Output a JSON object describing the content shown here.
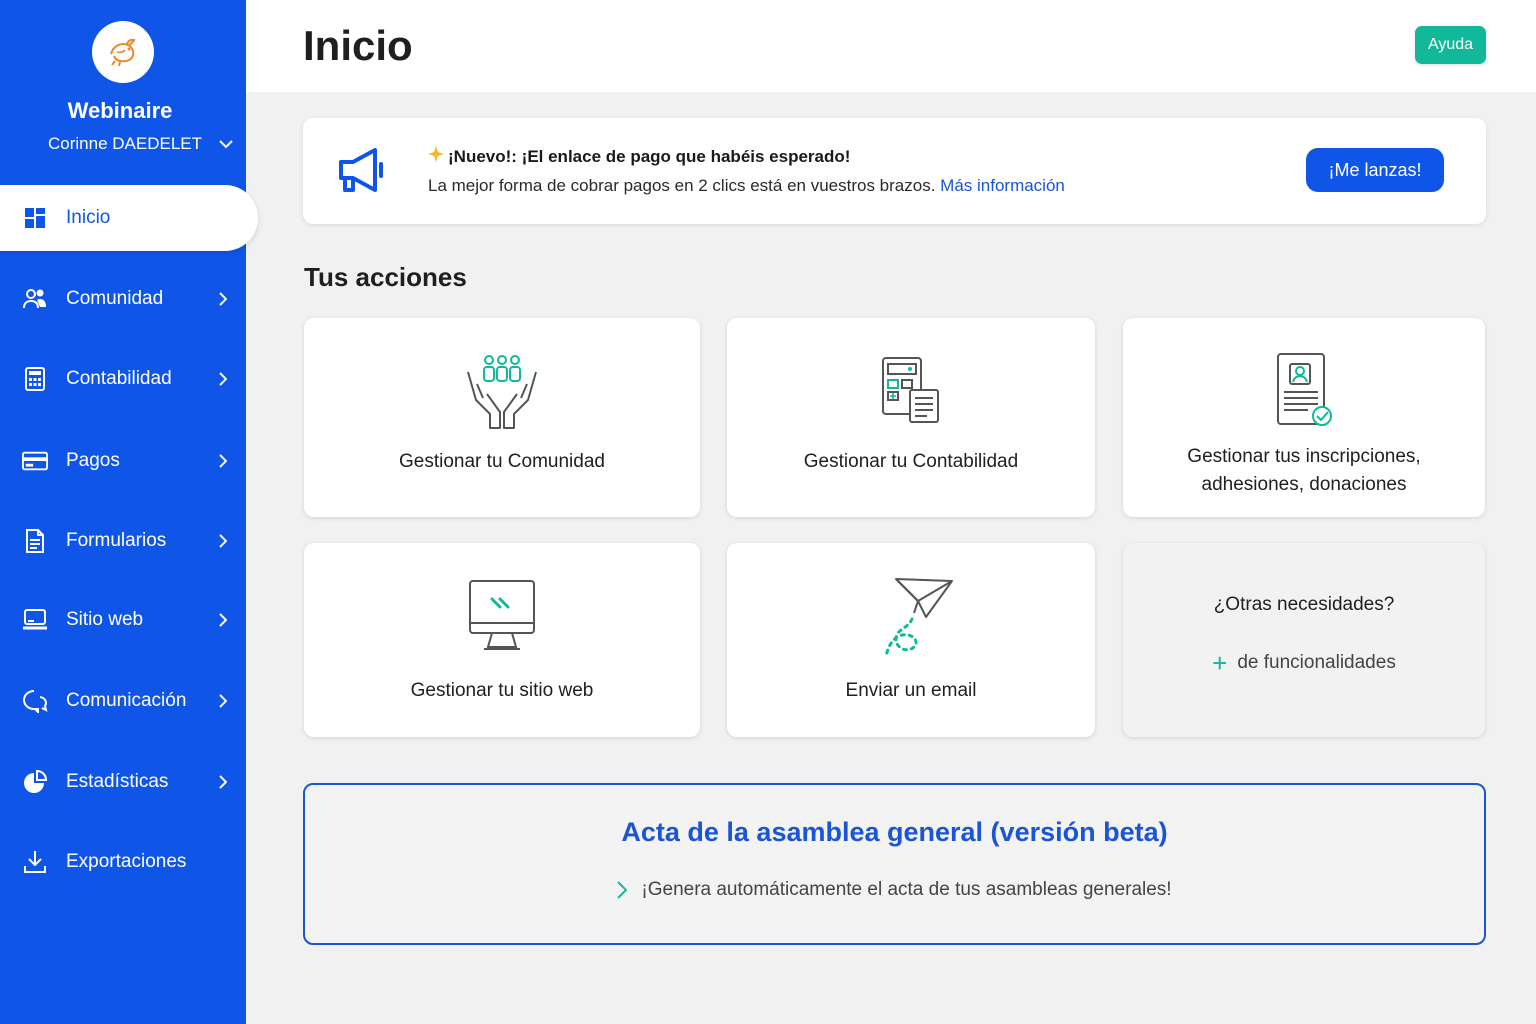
{
  "sidebar": {
    "org_name": "Webinaire",
    "user_name": "Corinne DAEDELET",
    "items": [
      {
        "label": "Inicio",
        "icon": "dashboard-icon"
      },
      {
        "label": "Comunidad",
        "icon": "people-icon"
      },
      {
        "label": "Contabilidad",
        "icon": "calculator-icon"
      },
      {
        "label": "Pagos",
        "icon": "credit-card-icon"
      },
      {
        "label": "Formularios",
        "icon": "document-icon"
      },
      {
        "label": "Sitio web",
        "icon": "laptop-icon"
      },
      {
        "label": "Comunicación",
        "icon": "chat-icon"
      },
      {
        "label": "Estadísticas",
        "icon": "pie-chart-icon"
      },
      {
        "label": "Exportaciones",
        "icon": "download-icon"
      }
    ]
  },
  "header": {
    "title": "Inicio",
    "help_label": "Ayuda"
  },
  "announcement": {
    "title": "¡Nuevo!: ¡El enlace de pago que habéis esperado!",
    "text": "La mejor forma de cobrar pagos en 2 clics está en vuestros brazos.",
    "link": "Más información",
    "button": "¡Me lanzas!"
  },
  "actions": {
    "title": "Tus acciones",
    "cards": [
      {
        "label": "Gestionar tu Comunidad",
        "icon": "hands-community-icon"
      },
      {
        "label": "Gestionar tu Contabilidad",
        "icon": "accounting-icon"
      },
      {
        "label": "Gestionar tus inscripciones, adhesiones, donaciones",
        "icon": "registration-doc-icon"
      },
      {
        "label": "Gestionar tu sitio web",
        "icon": "monitor-icon"
      },
      {
        "label": "Enviar un email",
        "icon": "paper-plane-icon"
      }
    ],
    "other": {
      "title": "¿Otras necesidades?",
      "link": "de funcionalidades"
    }
  },
  "beta": {
    "title": "Acta de la asamblea general (versión beta)",
    "desc": "¡Genera automáticamente el acta de tus asambleas generales!"
  },
  "colors": {
    "primary": "#0f56e8",
    "accent": "#12b89a",
    "link": "#1a55d6"
  }
}
